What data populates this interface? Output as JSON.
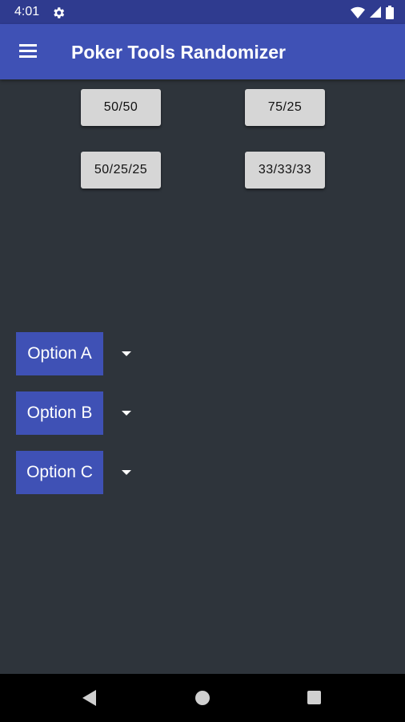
{
  "status_bar": {
    "time": "4:01",
    "icons": [
      "gear-icon",
      "wifi-icon",
      "cell-signal-icon",
      "battery-icon"
    ]
  },
  "app_bar": {
    "menu_icon": "hamburger-menu-icon",
    "title": "Poker Tools Randomizer"
  },
  "split_buttons": [
    {
      "label": "50/50"
    },
    {
      "label": "75/25"
    },
    {
      "label": "50/25/25"
    },
    {
      "label": "33/33/33"
    }
  ],
  "options": [
    {
      "label": "Option A",
      "icon": "dropdown-arrow-icon"
    },
    {
      "label": "Option B",
      "icon": "dropdown-arrow-icon"
    },
    {
      "label": "Option C",
      "icon": "dropdown-arrow-icon"
    }
  ],
  "nav_bar": {
    "icons": [
      "back-icon",
      "home-icon",
      "recents-icon"
    ]
  },
  "colors": {
    "status_bar": "#2f3b8f",
    "app_bar": "#3f51b5",
    "background": "#2e343b",
    "split_button": "#d6d6d6",
    "option_button": "#3f51b5",
    "nav_bar": "#000000"
  }
}
